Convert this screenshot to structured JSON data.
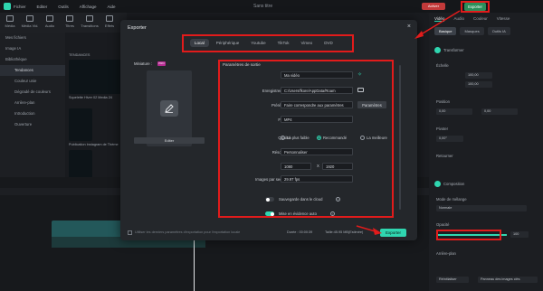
{
  "app": {
    "menu": [
      "Fichier",
      "Editer",
      "Outils",
      "Affichage",
      "Aide"
    ],
    "window_title": "Sans titre",
    "activate_label": "Activer",
    "export_label": "Exporter"
  },
  "toolbar": {
    "items": [
      "Média",
      "Média Vid.",
      "Audio",
      "Titres",
      "Transitions",
      "Effets"
    ]
  },
  "left_panel": {
    "items": [
      "Mes fichiers",
      "Image IA",
      "Bibliothèque",
      "Tendances",
      "Couleur unie",
      "Dégradé de couleurs",
      "Arrière-plan",
      "Introduction",
      "Ouverture"
    ]
  },
  "media": {
    "header": "TENDANCES",
    "items": [
      "Squelette Hiver 02 Media 24",
      "Publication Instagram de Thème"
    ]
  },
  "modal": {
    "title": "Exporter",
    "tabs": [
      "Local",
      "Périphérique",
      "Youtube",
      "TikTok",
      "Vimeo",
      "DVD"
    ],
    "active_tab": "Local",
    "miniature_label": "Miniature :",
    "miniature_badge": "PRO",
    "edit_button": "Editer",
    "settings_title": "Paramètres de sortie",
    "fields": {
      "name_label": "Nom",
      "name_value": "Ma vidéo",
      "save_label": "Enregistrer sous",
      "save_value": "C:/Users/fkore/AppData/Roam",
      "preset_label": "Préréglage",
      "preset_value": "Faire correspondre aux paramètres",
      "params_button": "Paramètres",
      "format_label": "Format",
      "format_value": "MP4",
      "quality_label": "Qualité",
      "quality_options": [
        "La plus faible",
        "Recommandé",
        "La meilleure"
      ],
      "quality_selected": "Recommandé",
      "resolution_label": "Résolution",
      "resolution_value": "Personnaliser",
      "width": "1080",
      "x_sep": "X",
      "height": "1920",
      "fps_label": "Images par seconde",
      "fps_value": "29.97 fps",
      "cloud_label": "Sauvegarde dans le cloud",
      "cloud_on": false,
      "auto_label": "Mise en évidence auto",
      "auto_on": true
    },
    "footer": {
      "checkbox_text": "Utiliser les derniers paramètres d'exportation pour l'exportation locale",
      "duration": "Durée : 00:00:39",
      "size": "Taille:45.95 MB(Estimée)",
      "export_button": "Exporter"
    }
  },
  "right_panel": {
    "tabs": [
      "Vidéo",
      "Audio",
      "Couleur",
      "Vitesse"
    ],
    "subtabs": [
      "Basique",
      "Masques",
      "Outils IA"
    ],
    "transform_label": "Transformer",
    "scale_label": "Échelle",
    "scale_x": "100,00",
    "scale_y": "100,00",
    "position_label": "Position",
    "pos_x": "0,00",
    "pos_y": "0,00",
    "rotate_label": "Pivoter",
    "rotate_value": "0,00°",
    "flip_label": "Retourner",
    "composition_label": "Composition",
    "blend_label": "Mode de mélange",
    "blend_value": "Normale",
    "opacity_label": "Opacité",
    "opacity_value": "100",
    "autoplay_label": "Arrière-plan",
    "reset_button": "Réinitialiser",
    "keyframe_button": "Panneau des images clés"
  },
  "colors": {
    "accent": "#2fd6b0",
    "highlight": "#e11b1b"
  }
}
